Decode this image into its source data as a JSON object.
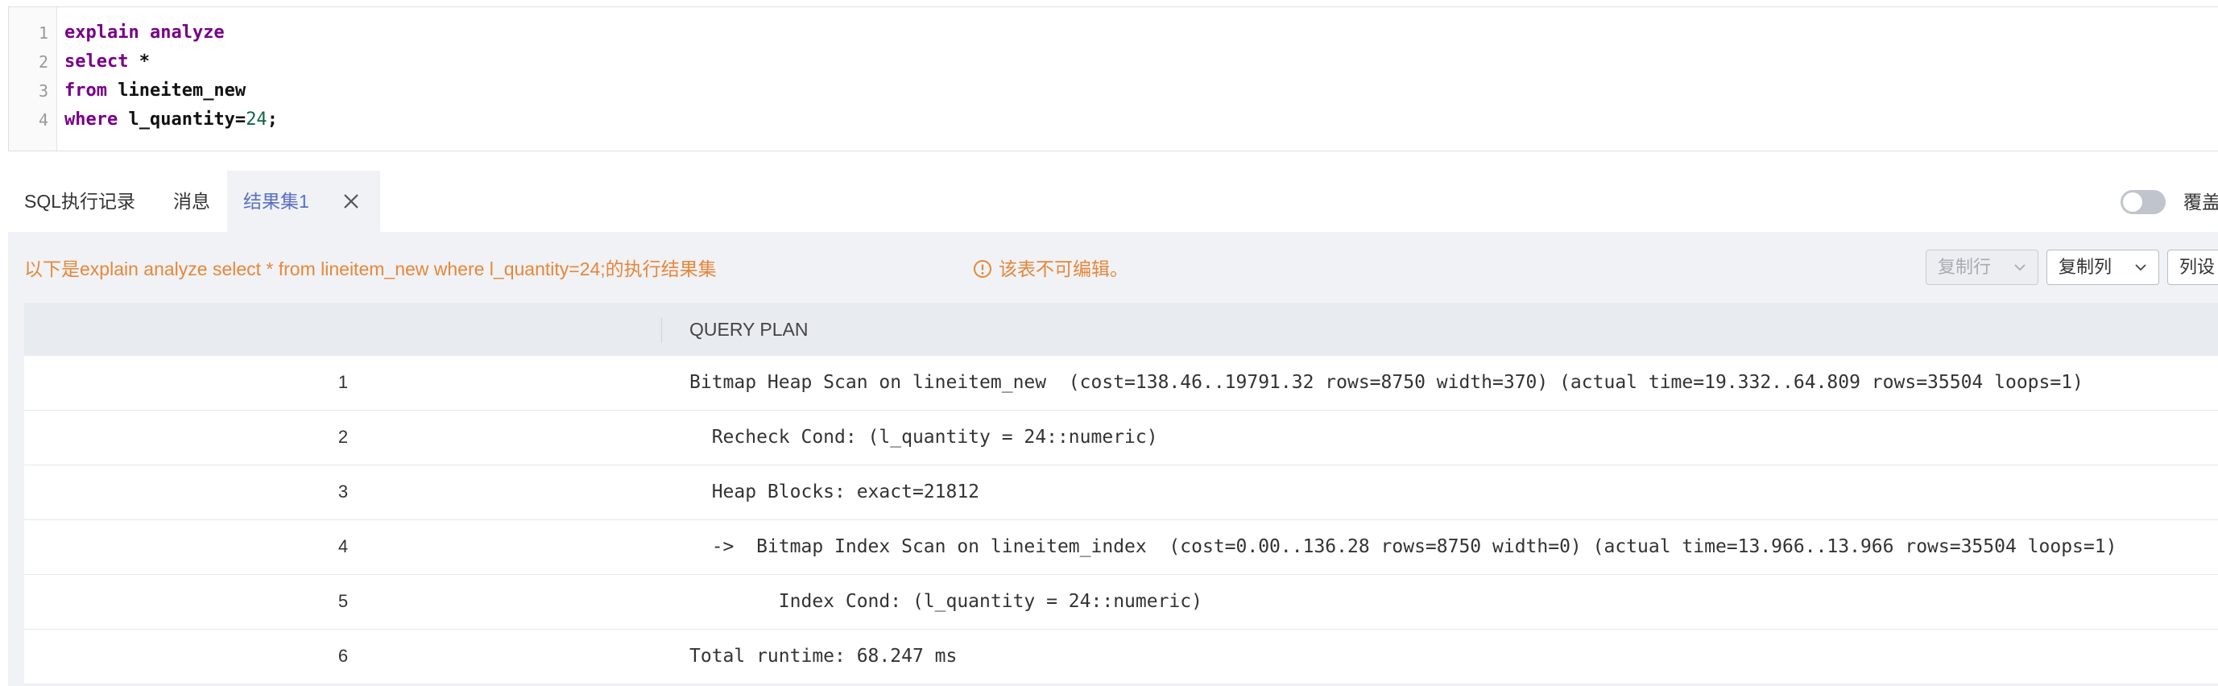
{
  "editor": {
    "line_numbers": [
      "1",
      "2",
      "3",
      "4"
    ],
    "lines": [
      {
        "kw": "explain analyze",
        "rest": "",
        "num": "",
        "tail": ""
      },
      {
        "kw": "select",
        "rest": " *",
        "num": "",
        "tail": ""
      },
      {
        "kw": "from",
        "rest": " lineitem_new",
        "num": "",
        "tail": ""
      },
      {
        "kw": "where",
        "rest": " l_quantity=",
        "num": "24",
        "tail": ";"
      }
    ]
  },
  "tabs": {
    "history": "SQL执行记录",
    "messages": "消息",
    "result": "结果集1"
  },
  "overlay_toggle": {
    "label": "覆盖",
    "on": false
  },
  "result": {
    "info_text": "以下是explain analyze select * from lineitem_new where l_quantity=24;的执行结果集",
    "warning": "该表不可编辑。",
    "buttons": {
      "copy_row": "复制行",
      "copy_col": "复制列",
      "col_settings": "列设"
    },
    "table": {
      "header": "QUERY PLAN",
      "rows": [
        {
          "idx": "1",
          "plan": "Bitmap Heap Scan on lineitem_new  (cost=138.46..19791.32 rows=8750 width=370) (actual time=19.332..64.809 rows=35504 loops=1)"
        },
        {
          "idx": "2",
          "plan": "  Recheck Cond: (l_quantity = 24::numeric)"
        },
        {
          "idx": "3",
          "plan": "  Heap Blocks: exact=21812"
        },
        {
          "idx": "4",
          "plan": "  ->  Bitmap Index Scan on lineitem_index  (cost=0.00..136.28 rows=8750 width=0) (actual time=13.966..13.966 rows=35504 loops=1)"
        },
        {
          "idx": "5",
          "plan": "        Index Cond: (l_quantity = 24::numeric)"
        },
        {
          "idx": "6",
          "plan": "Total runtime: 68.247 ms"
        }
      ]
    }
  },
  "colors": {
    "accent": "#5b6fc7",
    "warning": "#e6873a",
    "keyword": "#770088",
    "number": "#116644"
  }
}
